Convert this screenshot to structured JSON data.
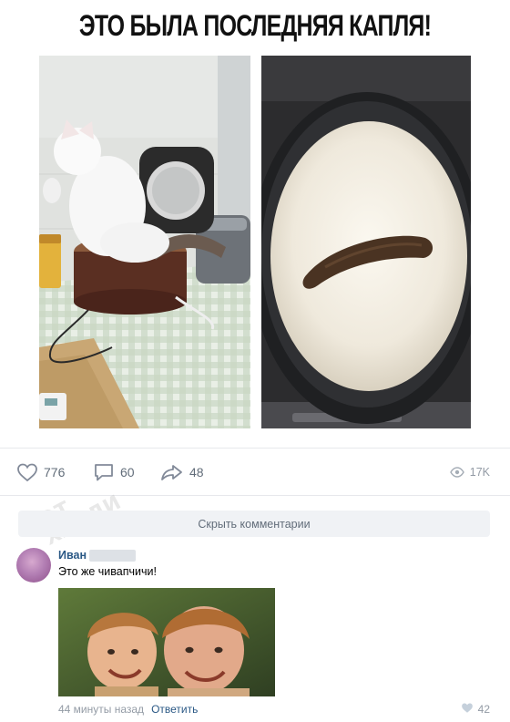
{
  "post": {
    "headline": "ЭТО БЫЛА ПОСЛЕДНЯЯ КАПЛЯ!"
  },
  "actions": {
    "likes": "776",
    "comments": "60",
    "shares": "48",
    "views": "17K"
  },
  "comments_section": {
    "hide_label": "Скрыть комментарии",
    "comment": {
      "author": "Иван",
      "text": "Это же чивапчичи!",
      "time": "44 минуты назад",
      "reply_label": "Ответить",
      "likes": "42"
    }
  },
  "watermark": {
    "line1": "БОТ",
    "line2": "ХАСЛИ"
  },
  "icons": {
    "like": "heart-icon",
    "comment": "comment-bubble-icon",
    "share": "share-arrow-icon",
    "views": "eye-icon"
  },
  "colors": {
    "link": "#2a5885",
    "muted": "#939ba5",
    "action": "#626d7a",
    "bar": "#f0f2f5"
  }
}
